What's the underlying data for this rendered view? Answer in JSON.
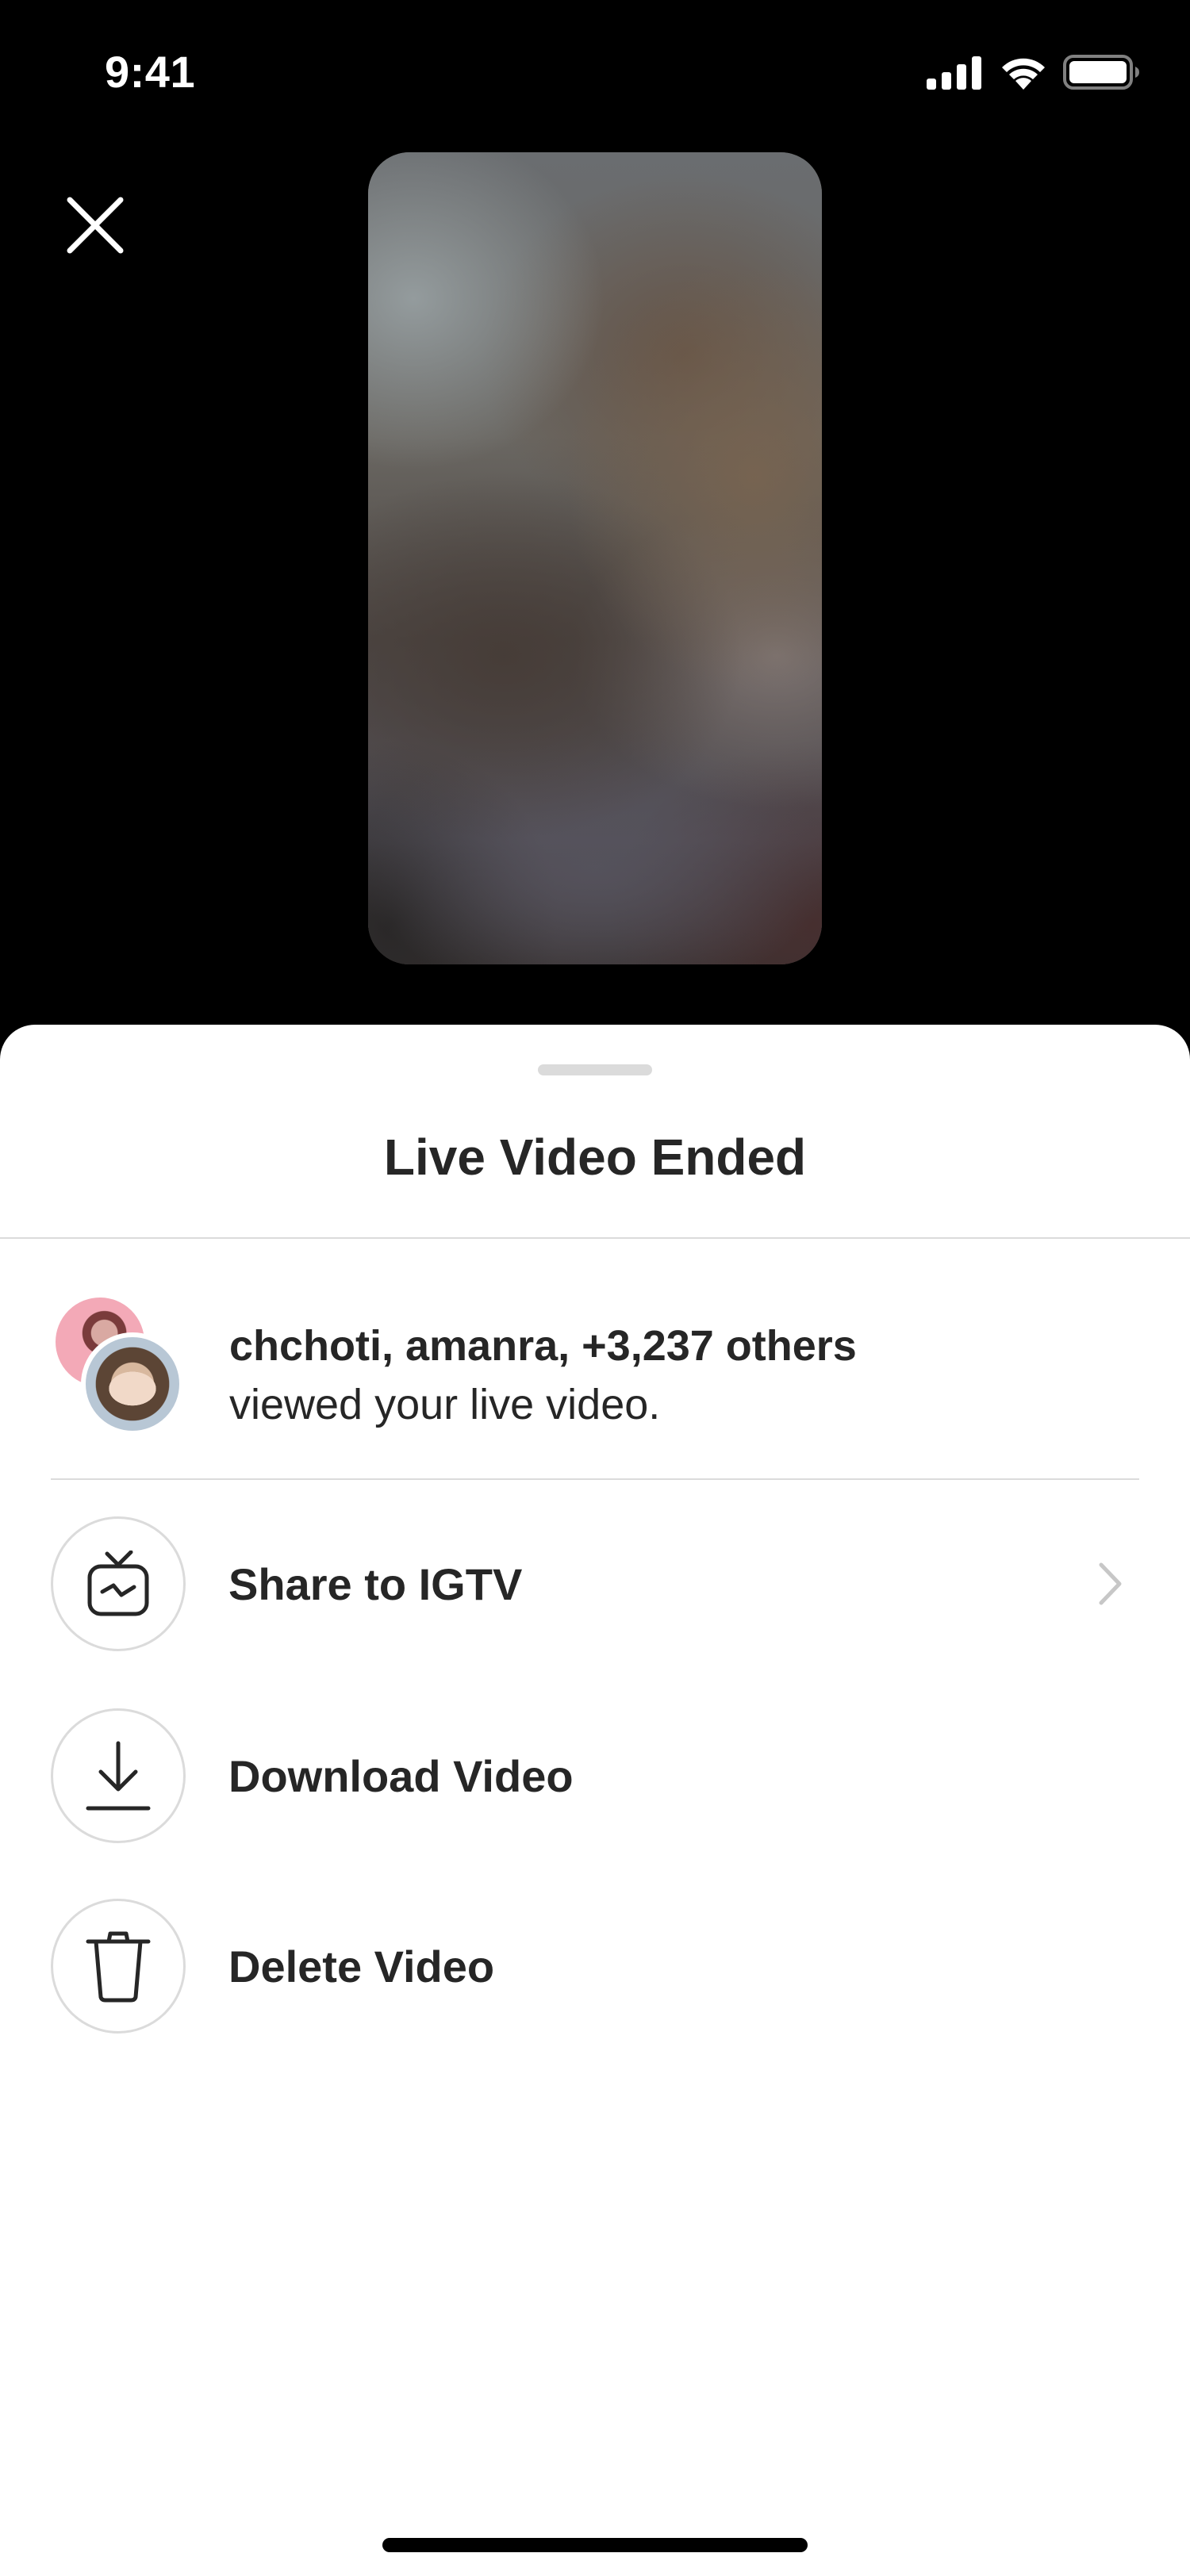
{
  "status_bar": {
    "time": "9:41",
    "icons": [
      "cellular-signal-icon",
      "wifi-icon",
      "battery-icon"
    ]
  },
  "close_button": {
    "icon": "close-icon"
  },
  "sheet": {
    "title": "Live Video Ended",
    "viewers": {
      "names": "chchoti, amanra, +3,237 others",
      "description": "viewed your live video."
    },
    "actions": [
      {
        "label": "Share to IGTV",
        "icon": "igtv-icon",
        "has_chevron": true
      },
      {
        "label": "Download Video",
        "icon": "download-icon",
        "has_chevron": false
      },
      {
        "label": "Delete Video",
        "icon": "trash-icon",
        "has_chevron": false
      }
    ]
  },
  "colors": {
    "background_top": "#000000",
    "sheet_background": "#ffffff",
    "text_primary": "#262626",
    "divider": "#dbdbdb",
    "chevron": "#c7c7c7"
  }
}
